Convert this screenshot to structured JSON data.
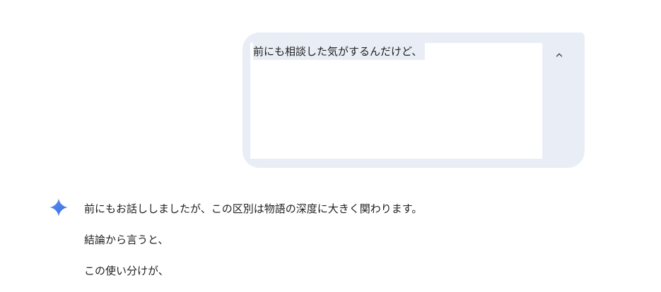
{
  "user_message": {
    "text": "前にも相談した気がするんだけど、",
    "collapse_icon": "chevron-up-icon"
  },
  "response": {
    "icon": "gemini-spark-icon",
    "paragraphs": [
      "前にもお話ししましたが、この区別は物語の深度に大きく関わります。",
      "結論から言うと、",
      "この使い分けが、"
    ]
  },
  "colors": {
    "bubble_bg": "#e9eef6",
    "spark_blue": "#4285f4",
    "text": "#1f1f1f"
  }
}
